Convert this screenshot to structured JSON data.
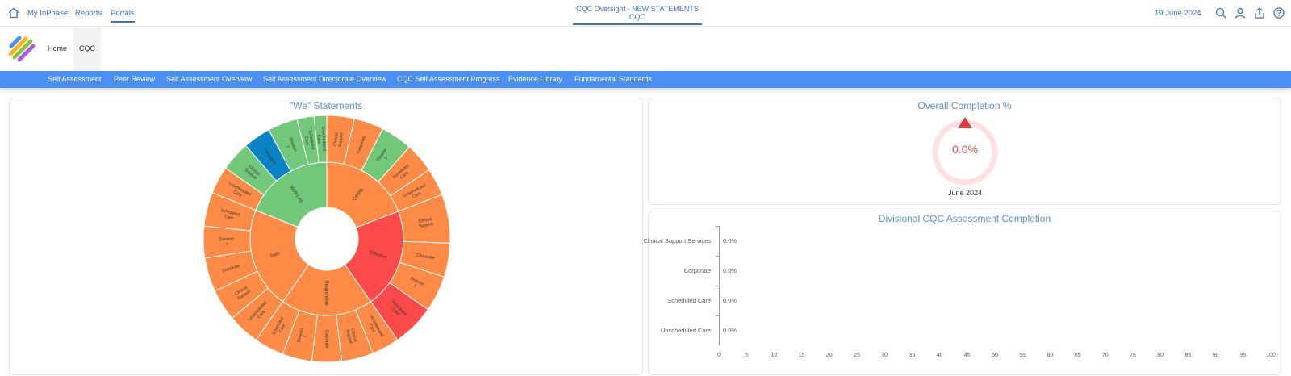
{
  "topbar": {
    "links": [
      "My InPhase",
      "Reports",
      "Portals"
    ],
    "title_line1": "CQC Oversight - NEW STATEMENTS",
    "title_line2": "CQC",
    "date": "19 June 2024"
  },
  "nav": {
    "home": "Home",
    "cqc": "CQC"
  },
  "menu": [
    "Self Assessment",
    "Peer Review",
    "Self Assessment Overview",
    "Self Assessment Directorate Overview",
    "CQC Self Assessment Progress",
    "Evidence Library",
    "Fundamental Standards"
  ],
  "colors": {
    "orange": "#fd8b45",
    "green": "#70c878",
    "red": "#fc4a4a",
    "blue": "#0a84c5",
    "accent": "#4a90f4"
  },
  "we_panel": {
    "title": "\"We\" Statements",
    "chart_data": {
      "type": "sunburst",
      "inner": [
        {
          "label": "Caring",
          "color": "orange"
        },
        {
          "label": "Effective",
          "color": "red"
        },
        {
          "label": "Responsive",
          "color": "orange"
        },
        {
          "label": "Safe",
          "color": "orange"
        },
        {
          "label": "Well-Led",
          "color": "green"
        }
      ],
      "outer": [
        {
          "label": "Clinical Support",
          "parent": "Caring",
          "color": "orange"
        },
        {
          "label": "Corporate",
          "parent": "Caring",
          "color": "orange"
        },
        {
          "label": "Division 1",
          "parent": "Caring",
          "color": "green"
        },
        {
          "label": "Scheduled Care",
          "parent": "Caring",
          "color": "orange"
        },
        {
          "label": "Unscheduled Care",
          "parent": "Caring",
          "color": "orange"
        },
        {
          "label": "Clinical Support",
          "parent": "Effective",
          "color": "orange"
        },
        {
          "label": "Corporate",
          "parent": "Effective",
          "color": "orange"
        },
        {
          "label": "Division 1",
          "parent": "Effective",
          "color": "orange"
        },
        {
          "label": "Scheduled Care",
          "parent": "Effective",
          "color": "red"
        },
        {
          "label": "Unscheduled Care",
          "parent": "Responsive",
          "color": "orange"
        },
        {
          "label": "Clinical Support",
          "parent": "Responsive",
          "color": "orange"
        },
        {
          "label": "Corporate",
          "parent": "Responsive",
          "color": "orange"
        },
        {
          "label": "Division 1",
          "parent": "Responsive",
          "color": "orange"
        },
        {
          "label": "Scheduled Care",
          "parent": "Responsive",
          "color": "orange"
        },
        {
          "label": "Unscheduled Care",
          "parent": "Safe",
          "color": "orange"
        },
        {
          "label": "Clinical Support",
          "parent": "Safe",
          "color": "orange"
        },
        {
          "label": "Corporate",
          "parent": "Safe",
          "color": "orange"
        },
        {
          "label": "Division 1",
          "parent": "Safe",
          "color": "orange"
        },
        {
          "label": "Scheduled Care",
          "parent": "Safe",
          "color": "orange"
        },
        {
          "label": "Unscheduled Care",
          "parent": "Safe",
          "color": "orange"
        },
        {
          "label": "Clinical Support",
          "parent": "Well-Led",
          "color": "green"
        },
        {
          "label": "Corporate",
          "parent": "Well-Led",
          "color": "blue"
        },
        {
          "label": "Division 1",
          "parent": "Well-Led",
          "color": "green"
        },
        {
          "label": "Scheduled Care",
          "parent": "Well-Led",
          "color": "green"
        },
        {
          "label": "Unscheduled Care",
          "parent": "Well-Led",
          "color": "green"
        }
      ]
    }
  },
  "completion_panel": {
    "title": "Overall Completion %",
    "value_text": "0.0%",
    "value": 0,
    "month": "June 2024",
    "trend": "up"
  },
  "division_panel": {
    "title": "Divisional CQC Assessment Completion",
    "chart_data": {
      "type": "bar",
      "orientation": "horizontal",
      "categories": [
        "Clinical Support Services",
        "Corporate",
        "Scheduled Care",
        "Unscheduled Care"
      ],
      "values": [
        0.0,
        0.0,
        0.0,
        0.0
      ],
      "value_labels": [
        "0.0%",
        "0.0%",
        "0.0%",
        "0.0%"
      ],
      "xlim": [
        0,
        100
      ],
      "xticks": [
        "0",
        "5",
        "10",
        "15",
        "20",
        "25",
        "30",
        "35",
        "40",
        "45",
        "50",
        "55",
        "60",
        "65",
        "70",
        "75",
        "80",
        "85",
        "90",
        "95",
        "100"
      ]
    }
  }
}
